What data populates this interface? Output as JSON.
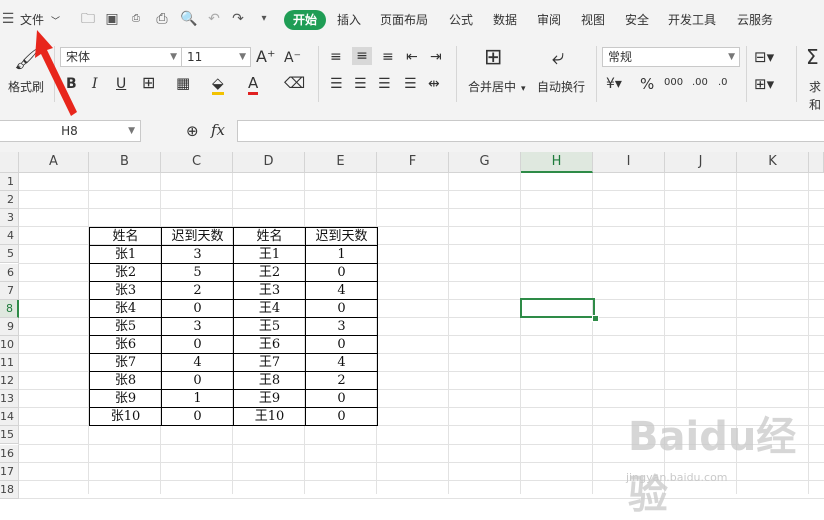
{
  "menu": {
    "file_label": "文件",
    "tabs": [
      "开始",
      "插入",
      "页面布局",
      "公式",
      "数据",
      "审阅",
      "视图",
      "安全",
      "开发工具",
      "云服务"
    ]
  },
  "ribbon": {
    "format_painter": "格式刷",
    "font_name": "宋体",
    "font_size": "11",
    "merge_center": "合并居中",
    "wrap_text": "自动换行",
    "number_format": "常规",
    "sum_label": "求和"
  },
  "formula_bar": {
    "cell_ref": "H8",
    "fx_label": "fx",
    "value": ""
  },
  "sheet": {
    "columns": [
      "A",
      "B",
      "C",
      "D",
      "E",
      "F",
      "G",
      "H",
      "I",
      "J",
      "K"
    ],
    "rows": [
      "1",
      "2",
      "3",
      "4",
      "5",
      "6",
      "7",
      "8",
      "9",
      "10",
      "11",
      "12",
      "13",
      "14",
      "15",
      "16",
      "17",
      "18"
    ],
    "selected_column": "H",
    "selected_row": "8"
  },
  "table": {
    "headers": [
      "姓名",
      "迟到天数",
      "姓名",
      "迟到天数"
    ],
    "rows": [
      [
        "张1",
        "3",
        "王1",
        "1"
      ],
      [
        "张2",
        "5",
        "王2",
        "0"
      ],
      [
        "张3",
        "2",
        "王3",
        "4"
      ],
      [
        "张4",
        "0",
        "王4",
        "0"
      ],
      [
        "张5",
        "3",
        "王5",
        "3"
      ],
      [
        "张6",
        "0",
        "王6",
        "0"
      ],
      [
        "张7",
        "4",
        "王7",
        "4"
      ],
      [
        "张8",
        "0",
        "王8",
        "2"
      ],
      [
        "张9",
        "1",
        "王9",
        "0"
      ],
      [
        "张10",
        "0",
        "王10",
        "0"
      ]
    ]
  },
  "watermark": {
    "brand": "Baidu经验",
    "url": "jingyan.baidu.com"
  },
  "colors": {
    "accent": "#1f9d55",
    "selection": "#2e8b47",
    "arrow": "#e8261c"
  }
}
